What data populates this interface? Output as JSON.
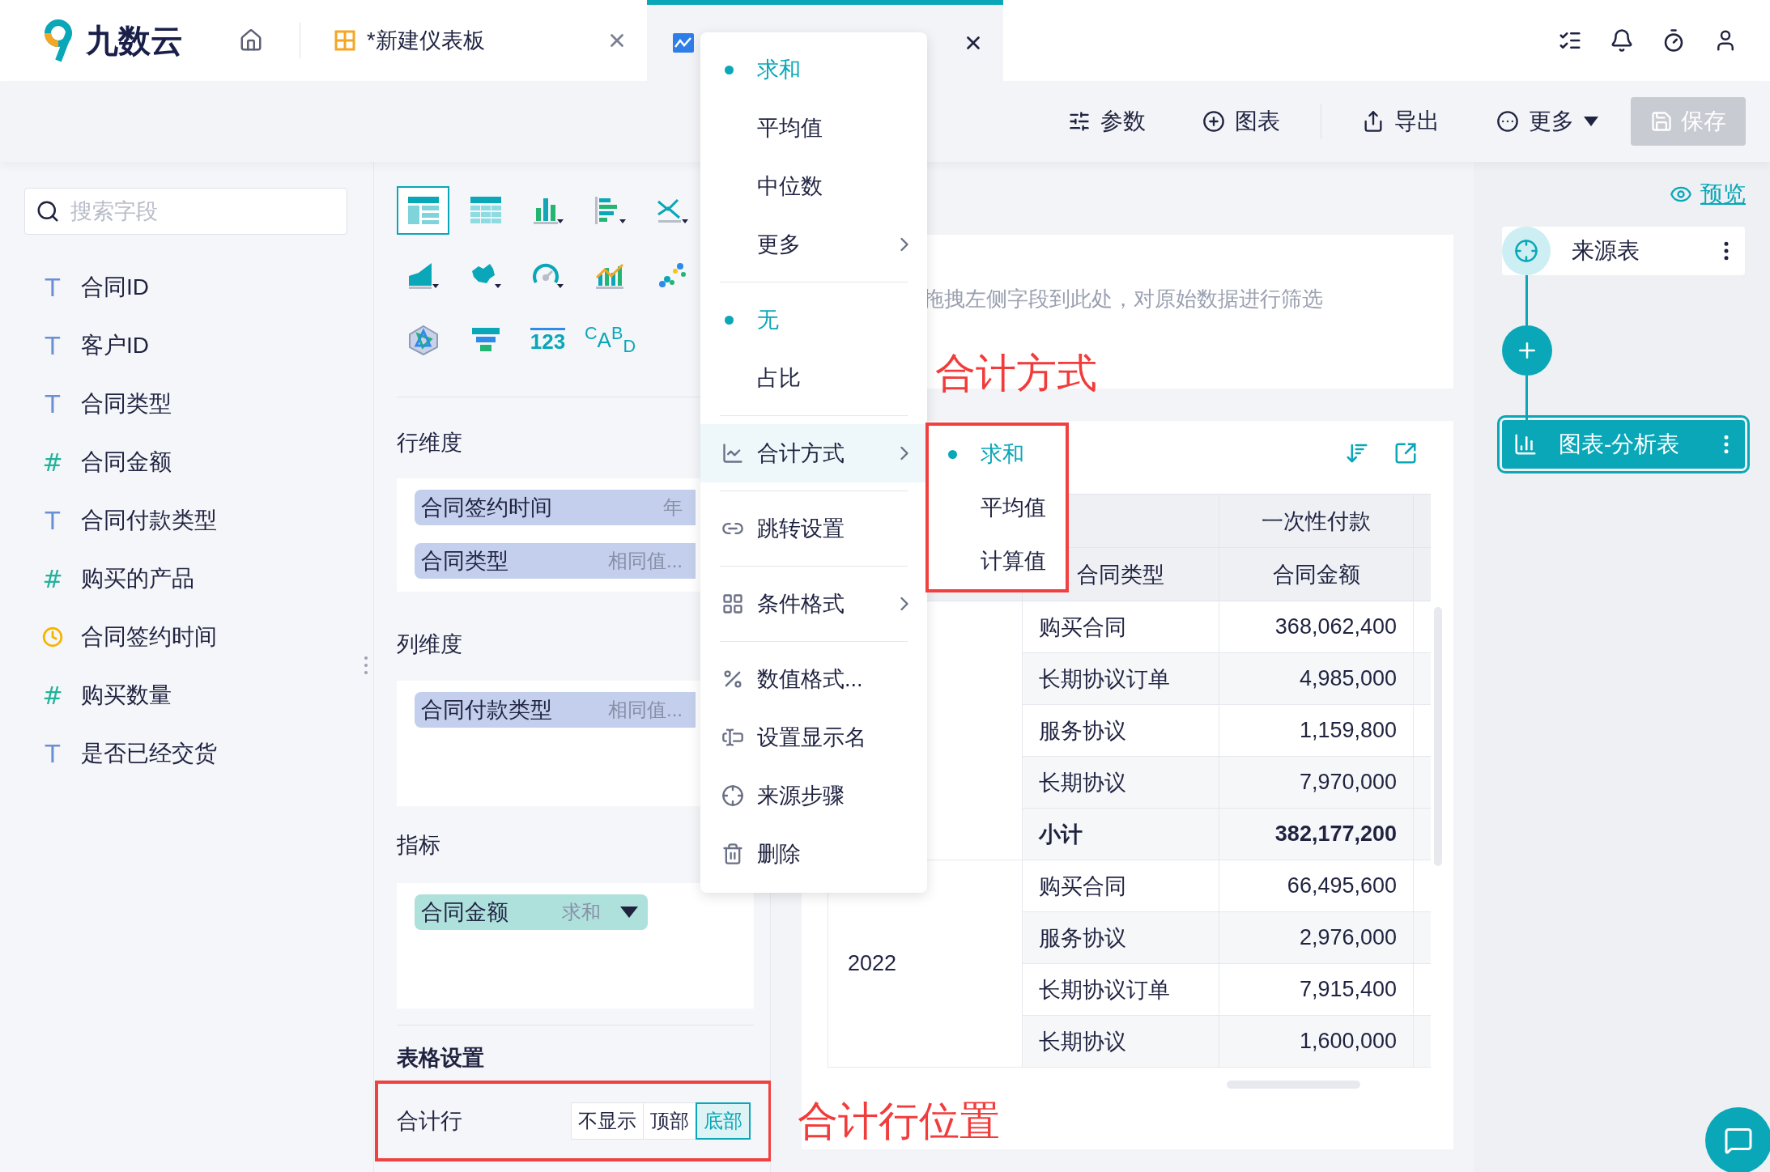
{
  "app": {
    "logo_text": "九数云"
  },
  "tabs": [
    {
      "kind": "dashboard",
      "label": "*新建仪表板",
      "selected": false
    },
    {
      "kind": "analysis",
      "selected": true
    }
  ],
  "toolbar": [
    {
      "label": "参数",
      "has_dropdown": false
    },
    {
      "label": "图表",
      "has_dropdown": false
    },
    {
      "label": "导出",
      "has_dropdown": false
    },
    {
      "label": "更多",
      "has_dropdown": true
    }
  ],
  "save_button": {
    "label": "保存",
    "disabled": true
  },
  "field_search": {
    "placeholder": "搜索字段"
  },
  "fields": [
    {
      "kind": "text",
      "mark": "T",
      "name": "合同ID"
    },
    {
      "kind": "text",
      "mark": "T",
      "name": "客户ID"
    },
    {
      "kind": "text",
      "mark": "T",
      "name": "合同类型"
    },
    {
      "kind": "number",
      "mark": "#",
      "name": "合同金额"
    },
    {
      "kind": "text",
      "mark": "T",
      "name": "合同付款类型"
    },
    {
      "kind": "number",
      "mark": "#",
      "name": "购买的产品"
    },
    {
      "kind": "date",
      "name": "合同签约时间"
    },
    {
      "kind": "number",
      "mark": "#",
      "name": "购买数量"
    },
    {
      "kind": "text",
      "mark": "T",
      "name": "是否已经交货"
    }
  ],
  "chart_types": [
    {
      "kind": "table",
      "selected": true
    },
    {
      "kind": "cross-table",
      "selected": false
    },
    {
      "kind": "bar",
      "selected": false
    },
    {
      "kind": "hbar",
      "selected": false
    },
    {
      "kind": "line",
      "selected": false
    },
    {
      "kind": "area",
      "selected": false
    },
    {
      "kind": "map",
      "selected": false
    },
    {
      "kind": "gauge",
      "selected": false
    },
    {
      "kind": "combo",
      "selected": false
    },
    {
      "kind": "scatter",
      "selected": false
    },
    {
      "kind": "radar",
      "selected": false
    },
    {
      "kind": "funnel",
      "selected": false
    },
    {
      "kind": "number",
      "glyph": "123",
      "selected": false
    },
    {
      "kind": "text",
      "glyph": "$^{C}$A$^{B}$$_{D}$",
      "selected": false
    }
  ],
  "row_dimensions": {
    "title": "行维度",
    "pills": [
      {
        "label": "合同签约时间",
        "tag": "年"
      },
      {
        "label": "合同类型",
        "tag": "相同值..."
      }
    ]
  },
  "column_dimensions": {
    "title": "列维度",
    "pills": [
      {
        "label": "合同付款类型",
        "tag": "相同值..."
      }
    ]
  },
  "measures": {
    "title": "指标",
    "pills": [
      {
        "label": "合同金额",
        "tag": "求和",
        "has_dropdown": true
      }
    ]
  },
  "table_settings": {
    "title": "表格设置",
    "total_row": {
      "label": "合计行",
      "annotated": true,
      "options": [
        {
          "label": "不显示",
          "selected": false
        },
        {
          "label": "顶部",
          "selected": false
        },
        {
          "label": "底部",
          "selected": true
        }
      ]
    }
  },
  "filter_hint": "拖拽左侧字段到此处，对原始数据进行筛选",
  "table": {
    "column_group": "一次性付款",
    "columns": [
      "合同类型",
      "合同金额"
    ],
    "groups": [
      {
        "rows": [
          {
            "kind": "row",
            "type": "购买合同",
            "amount": "368,062,400"
          },
          {
            "kind": "row",
            "type": "长期协议订单",
            "amount": "4,985,000"
          },
          {
            "kind": "row",
            "type": "服务协议",
            "amount": "1,159,800"
          },
          {
            "kind": "row",
            "type": "长期协议",
            "amount": "7,970,000"
          },
          {
            "kind": "subtotal",
            "type": "小计",
            "amount": "382,177,200"
          }
        ]
      },
      {
        "year": "2022",
        "rows": [
          {
            "kind": "row",
            "type": "购买合同",
            "amount": "66,495,600"
          },
          {
            "kind": "row",
            "type": "服务协议",
            "amount": "2,976,000"
          },
          {
            "kind": "row",
            "type": "长期协议订单",
            "amount": "7,915,400"
          },
          {
            "kind": "row",
            "type": "长期协议",
            "amount": "1,600,000"
          }
        ]
      }
    ]
  },
  "context_menu": {
    "sections": [
      {
        "items": [
          {
            "kind": "radio",
            "label": "求和",
            "selected": true
          },
          {
            "kind": "radio",
            "label": "平均值",
            "selected": false
          },
          {
            "kind": "radio",
            "label": "中位数",
            "selected": false
          },
          {
            "kind": "more",
            "label": "更多"
          }
        ]
      },
      {
        "items": [
          {
            "kind": "radio",
            "label": "无",
            "selected": true
          },
          {
            "kind": "radio",
            "label": "占比",
            "selected": false
          }
        ]
      },
      {
        "items": [
          {
            "kind": "action",
            "label": "合计方式",
            "has_submenu": true,
            "highlighted": true
          }
        ]
      },
      {
        "items": [
          {
            "kind": "action",
            "label": "跳转设置",
            "has_submenu": false,
            "highlighted": false
          }
        ]
      },
      {
        "items": [
          {
            "kind": "action",
            "label": "条件格式",
            "has_submenu": true,
            "highlighted": false
          }
        ]
      },
      {
        "items": [
          {
            "kind": "action",
            "label": "数值格式...",
            "has_submenu": false,
            "highlighted": false
          },
          {
            "kind": "action",
            "label": "设置显示名",
            "has_submenu": false,
            "highlighted": false
          },
          {
            "kind": "action",
            "label": "来源步骤",
            "has_submenu": false,
            "highlighted": false
          },
          {
            "kind": "action",
            "label": "删除",
            "has_submenu": false,
            "highlighted": false
          }
        ]
      }
    ]
  },
  "submenu": {
    "annotated": true,
    "items": [
      {
        "label": "求和",
        "selected": true
      },
      {
        "label": "平均值",
        "selected": false
      },
      {
        "label": "计算值",
        "selected": false
      }
    ]
  },
  "annotations": [
    {
      "text": "合计方式"
    },
    {
      "text": "合计行位置"
    }
  ],
  "flow": {
    "preview_link": "预览",
    "nodes": [
      {
        "kind": "source",
        "label": "来源表",
        "selected": false
      },
      {
        "kind": "chart",
        "label": "图表-分析表",
        "selected": true
      }
    ]
  }
}
